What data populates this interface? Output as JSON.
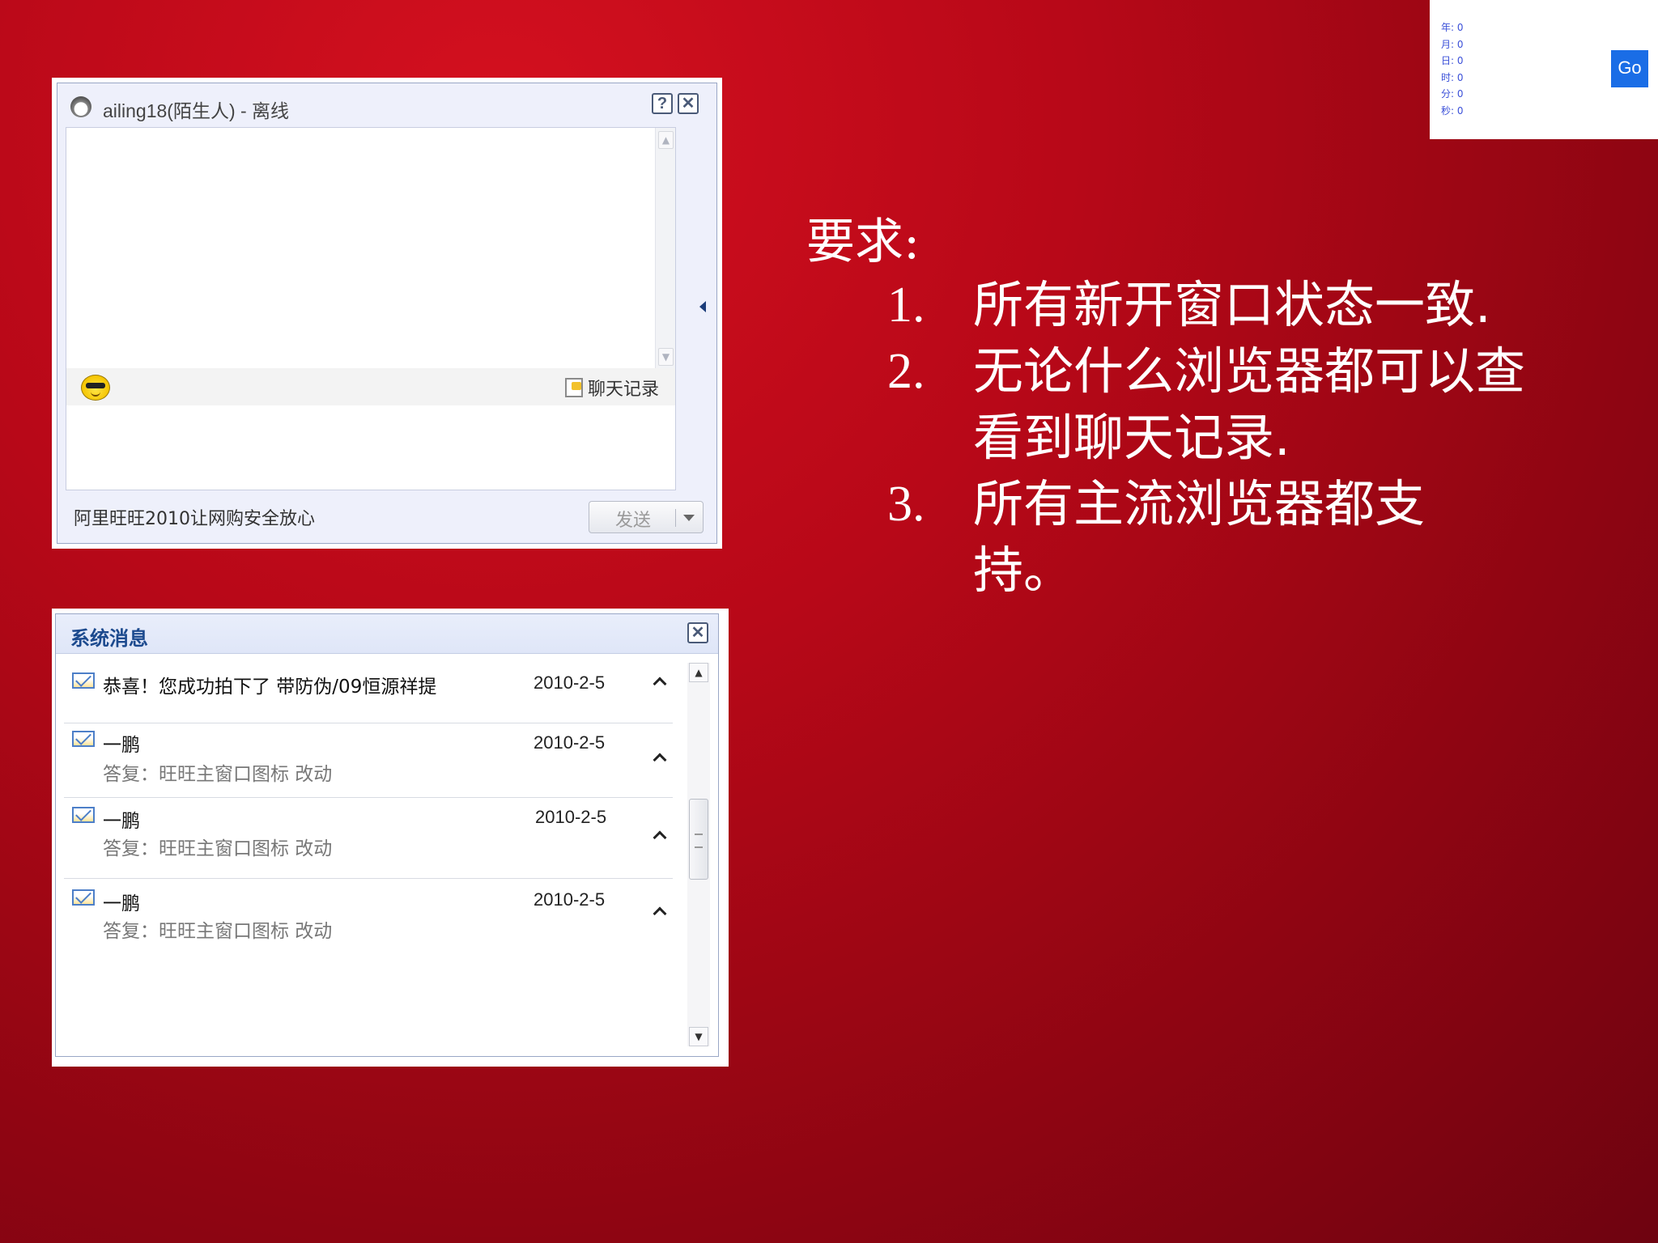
{
  "chat_window": {
    "title": "ailing18(陌生人) - 离线",
    "history_button": "聊天记录",
    "slogan": "阿里旺旺2010让网购安全放心",
    "send_button": "发送",
    "help_glyph": "?",
    "close_glyph": "✕"
  },
  "system_messages": {
    "title": "系统消息",
    "close_glyph": "✕",
    "items": [
      {
        "subject": "恭喜！您成功拍下了  带防伪/09恒源祥提",
        "body": "",
        "date": "2010-2-5"
      },
      {
        "subject": "一鹏",
        "body": "答复：旺旺主窗口图标 改动",
        "date": "2010-2-5"
      },
      {
        "subject": "一鹏",
        "body": "答复：旺旺主窗口图标 改动",
        "date": "2010-2-5"
      },
      {
        "subject": "一鹏",
        "body": "答复：旺旺主窗口图标 改动",
        "date": "2010-2-5"
      }
    ]
  },
  "requirements": {
    "heading": "要求:",
    "items": [
      {
        "num": "1.",
        "text": "所有新开窗口状态一致."
      },
      {
        "num": "2.",
        "text": "无论什么浏览器都可以查看到聊天记录."
      },
      {
        "num": "3.",
        "text": "所有主流浏览器都支持。"
      }
    ]
  },
  "time_panel": {
    "rows": [
      "年: 0",
      "月: 0",
      "日: 0",
      "时: 0",
      "分: 0",
      "秒: 0"
    ],
    "go_button": "Go"
  },
  "colors": {
    "background": "#b80818",
    "link_blue": "#1c4a8e",
    "go_button": "#1a6de6"
  },
  "icons": [
    "avatar-icon",
    "help-icon",
    "close-icon",
    "emoticon-icon",
    "chat-history-icon",
    "envelope-icon",
    "chevron-up-icon",
    "dropdown-arrow-icon"
  ]
}
